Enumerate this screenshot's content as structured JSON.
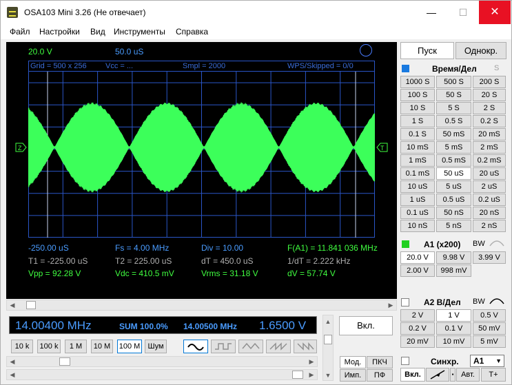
{
  "window": {
    "title": "OSA103 Mini 3.26 (Не отвечает)",
    "min": "—",
    "max": "☐",
    "close": "✕"
  },
  "menu": [
    "Файл",
    "Настройки",
    "Вид",
    "Инструменты",
    "Справка"
  ],
  "scope": {
    "volt_div": "20.0 V",
    "time_div": "50.0 uS",
    "grid_info": "Grid = 500 x 256",
    "vcc": "Vcc = ...",
    "smpl": "Smpl = 2000",
    "wps": "WPS/Skipped  = 0/0",
    "left_marker": "Z",
    "right_marker": "T",
    "meas": {
      "t_start": "-250.00 uS",
      "fs": "Fs = 4.00 MHz",
      "div": "Div = 10.00",
      "freq": "F(A1) = 11.841 036 MHz",
      "t1": "T1 = -225.00 uS",
      "t2": "T2 = 225.00 uS",
      "dt": "dT = 450.0 uS",
      "inv_dt": "1/dT = 2.222 kHz",
      "vpp": "Vpp = 92.28 V",
      "vdc": "Vdc = 410.5 mV",
      "vrms": "Vrms = 31.18 V",
      "dv": "dV = 57.74 V"
    },
    "colors": {
      "trace": "#3cff5a",
      "grid": "#2a56c8"
    }
  },
  "generator": {
    "freq": "14.00400 MHz",
    "sum": "SUM 100.0%",
    "freq2": "14.00500 MHz",
    "ampl": "1.6500 V",
    "on_label": "Вкл.",
    "steps": [
      "10 k",
      "100 k",
      "1 M",
      "10 M",
      "100 M"
    ],
    "noise": "Шум",
    "mode_labels": [
      "Мод.",
      "ПКЧ",
      "Имп.",
      "ПФ"
    ]
  },
  "right": {
    "start": "Пуск",
    "single": "Однокр.",
    "time_header": "Время/Дел",
    "time_s": "S",
    "time_buttons": [
      [
        "1000 S",
        "500 S",
        "200 S"
      ],
      [
        "100 S",
        "50 S",
        "20 S"
      ],
      [
        "10 S",
        "5 S",
        "2 S"
      ],
      [
        "1 S",
        "0.5 S",
        "0.2 S"
      ],
      [
        "0.1 S",
        "50 mS",
        "20 mS"
      ],
      [
        "10 mS",
        "5 mS",
        "2 mS"
      ],
      [
        "1 mS",
        "0.5 mS",
        "0.2 mS"
      ],
      [
        "0.1 mS",
        "50 uS",
        "20 uS"
      ],
      [
        "10 uS",
        "5 uS",
        "2 uS"
      ],
      [
        "1 uS",
        "0.5 uS",
        "0.2 uS"
      ],
      [
        "0.1 uS",
        "50 nS",
        "20 nS"
      ],
      [
        "10 nS",
        "5 nS",
        "2 nS"
      ]
    ],
    "a1_header": "A1 (x200)",
    "bw": "BW",
    "a1_buttons": [
      [
        "20.0 V",
        "9.98 V",
        "3.99 V"
      ],
      [
        "2.00 V",
        "998 mV"
      ]
    ],
    "a2_header": "A2 В/Дел",
    "a2_buttons": [
      [
        "2 V",
        "1 V",
        "0.5 V"
      ],
      [
        "0.2 V",
        "0.1 V",
        "50 mV"
      ],
      [
        "20 mV",
        "10 mV",
        "5 mV"
      ]
    ],
    "sync_label": "Синхр.",
    "sync_value": "A1",
    "sync_buttons": [
      "Вкл.",
      "Авт.",
      "T+"
    ]
  }
}
